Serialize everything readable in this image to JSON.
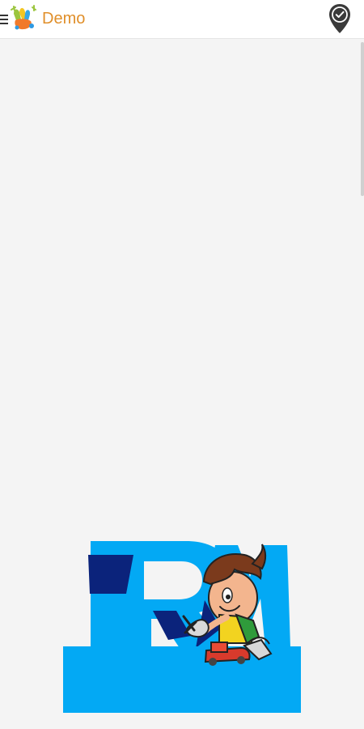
{
  "header": {
    "title": "Demo",
    "menu_icon": "hamburger-menu-icon",
    "logo_icon": "hand-paint-logo-icon",
    "location_icon": "location-check-pin-icon"
  },
  "illustration": {
    "type": "brand-artwork",
    "colors": {
      "primary": "#03a9f4",
      "dark": "#0b237b",
      "accent": "#e08f2a"
    }
  }
}
